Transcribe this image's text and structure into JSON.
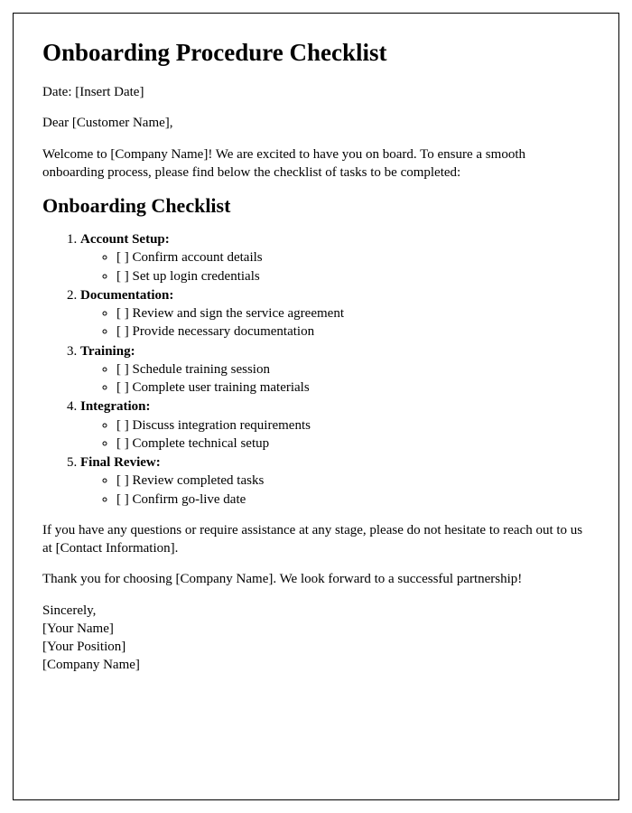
{
  "title": "Onboarding Procedure Checklist",
  "date_line": "Date: [Insert Date]",
  "greeting": "Dear [Customer Name],",
  "intro": "Welcome to [Company Name]! We are excited to have you on board. To ensure a smooth onboarding process, please find below the checklist of tasks to be completed:",
  "checklist_heading": "Onboarding Checklist",
  "sections": [
    {
      "title": "Account Setup:",
      "items": [
        "[ ] Confirm account details",
        "[ ] Set up login credentials"
      ]
    },
    {
      "title": "Documentation:",
      "items": [
        "[ ] Review and sign the service agreement",
        "[ ] Provide necessary documentation"
      ]
    },
    {
      "title": "Training:",
      "items": [
        "[ ] Schedule training session",
        "[ ] Complete user training materials"
      ]
    },
    {
      "title": "Integration:",
      "items": [
        "[ ] Discuss integration requirements",
        "[ ] Complete technical setup"
      ]
    },
    {
      "title": "Final Review:",
      "items": [
        "[ ] Review completed tasks",
        "[ ] Confirm go-live date"
      ]
    }
  ],
  "assistance": "If you have any questions or require assistance at any stage, please do not hesitate to reach out to us at [Contact Information].",
  "thanks": "Thank you for choosing [Company Name]. We look forward to a successful partnership!",
  "signature": {
    "closing": "Sincerely,",
    "name": "[Your Name]",
    "position": "[Your Position]",
    "company": "[Company Name]"
  }
}
